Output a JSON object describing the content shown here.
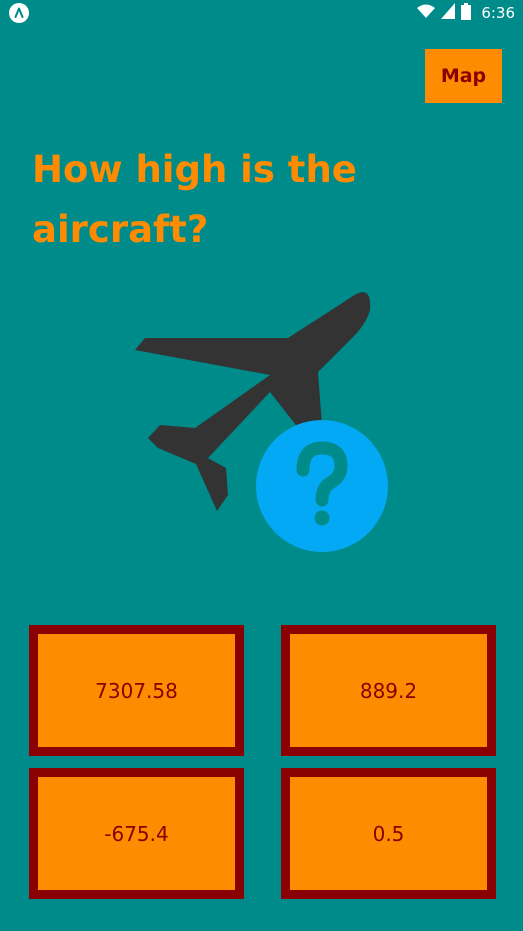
{
  "status_bar": {
    "time": "6:36",
    "app_icon": "react-native-icon",
    "icons": [
      "wifi-icon",
      "cellular-signal-icon",
      "battery-icon"
    ]
  },
  "header": {
    "map_button_label": "Map"
  },
  "question": {
    "text": "How high is the aircraft?"
  },
  "illustration": {
    "icons": [
      "airplane-icon",
      "question-mark-icon"
    ]
  },
  "answers": [
    {
      "label": "7307.58"
    },
    {
      "label": "889.2"
    },
    {
      "label": "-675.4"
    },
    {
      "label": "0.5"
    }
  ],
  "colors": {
    "background": "#008B8B",
    "accent": "#FF8C00",
    "border": "#8B0000",
    "airplane": "#333333",
    "question_badge": "#03A9F4"
  }
}
